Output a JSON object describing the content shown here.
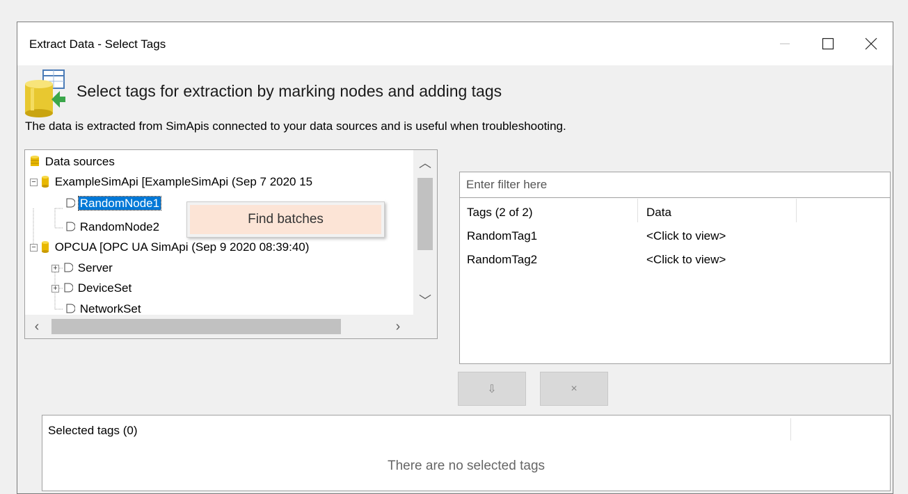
{
  "window": {
    "title": "Extract Data - Select Tags",
    "controls": [
      "minimize-icon",
      "maximize-icon",
      "close-icon"
    ]
  },
  "header": {
    "heading": "Select tags for extraction by marking nodes and adding tags",
    "description": "The data is extracted from SimApis connected to your data sources and is useful when troubleshooting.",
    "icon": "database-table-icon"
  },
  "tree": {
    "items": [
      {
        "label": "Data sources",
        "icon": "datasource-icon"
      },
      {
        "label": "ExampleSimApi [ExampleSimApi (Sep  7 2020 15",
        "icon": "cylinder-icon",
        "expander": "−"
      },
      {
        "label": "RandomNode1",
        "icon": "node-icon",
        "selected": true
      },
      {
        "label": "RandomNode2",
        "icon": "node-icon"
      },
      {
        "label": "OPCUA [OPC UA SimApi (Sep  9 2020 08:39:40)",
        "icon": "cylinder-icon",
        "expander": "−"
      },
      {
        "label": "Server",
        "icon": "node-icon",
        "expander": "+"
      },
      {
        "label": "DeviceSet",
        "icon": "node-icon",
        "expander": "+"
      },
      {
        "label": "NetworkSet",
        "icon": "node-icon"
      }
    ]
  },
  "context_menu": {
    "items": [
      {
        "label": "Find batches"
      }
    ]
  },
  "filter": {
    "placeholder": "Enter filter here",
    "columns": [
      "Tags (2 of 2)",
      "Data"
    ],
    "rows": [
      {
        "tag": "RandomTag1",
        "data": "<Click to view>"
      },
      {
        "tag": "RandomTag2",
        "data": "<Click to view>"
      }
    ]
  },
  "actions": {
    "add_icon": "⇩",
    "remove_icon": "×"
  },
  "selected": {
    "header": "Selected tags (0)",
    "empty_message": "There are no selected tags"
  },
  "colors": {
    "selection": "#0078d7",
    "context_highlight": "#fce4d6",
    "datasource_icon": "#e8b800"
  }
}
